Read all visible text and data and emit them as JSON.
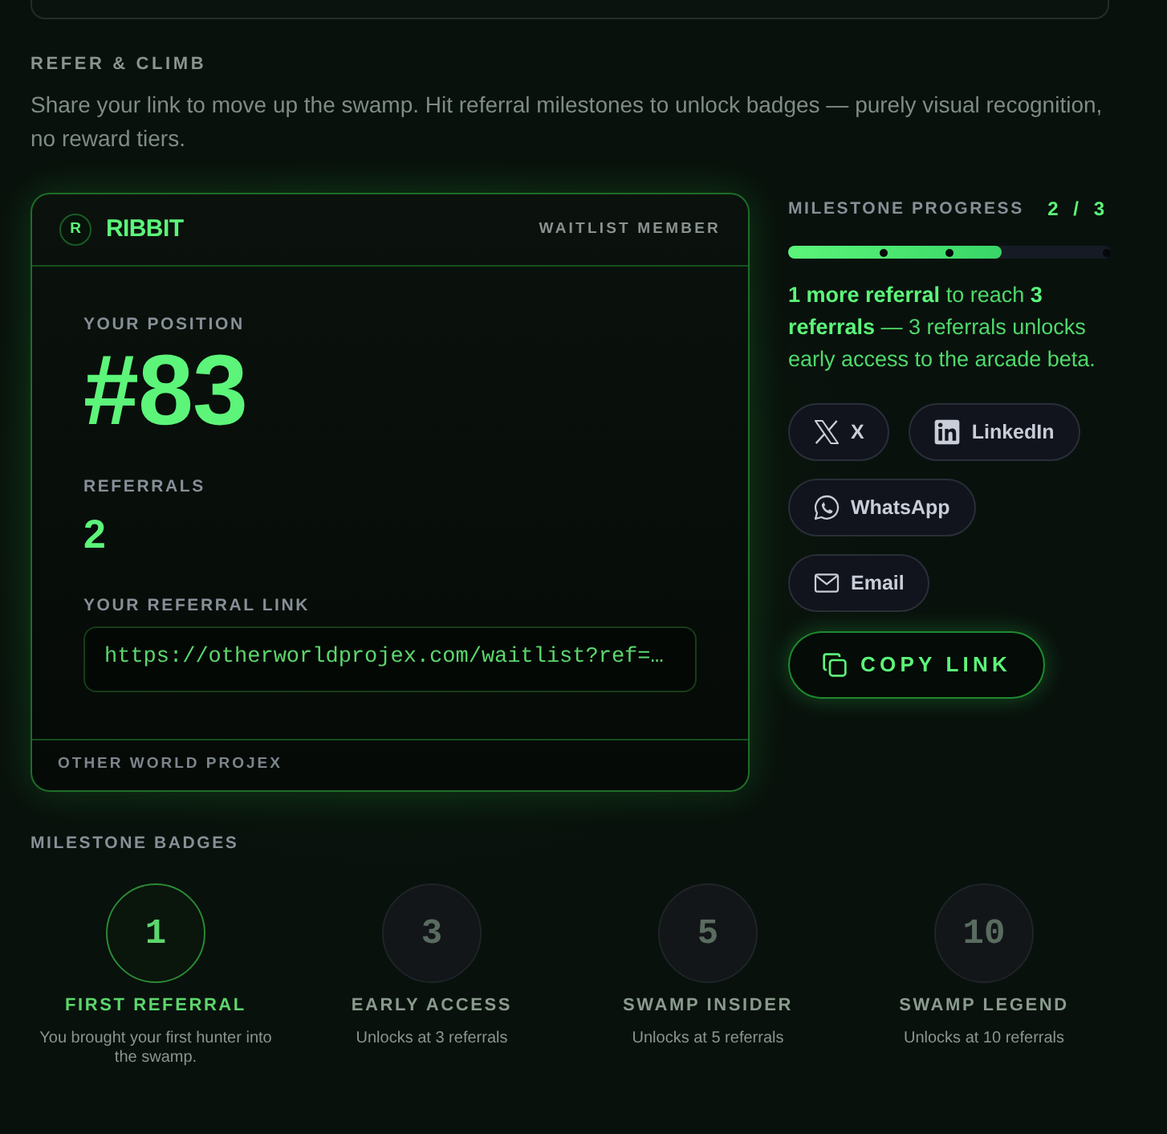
{
  "section": {
    "heading": "REFER & CLIMB",
    "description": "Share your link to move up the swamp. Hit referral milestones to unlock badges — purely visual recognition, no reward tiers."
  },
  "card": {
    "avatar": "R",
    "brand": "RIBBIT",
    "tag": "WAITLIST MEMBER",
    "position_label": "YOUR POSITION",
    "position": "#83",
    "referrals_label": "REFERRALS",
    "referrals": "2",
    "link_label": "YOUR REFERRAL LINK",
    "link": "https://otherworldprojex.com/waitlist?ref=…",
    "footer": "OTHER WORLD PROJEX"
  },
  "progress": {
    "label": "MILESTONE PROGRESS",
    "count": "2 / 3",
    "level": 0.66,
    "message": "**1 more referral** to reach **3 referrals** — 3 referrals unlocks early access to the arcade beta."
  },
  "share_buttons": [
    {
      "kind": "x",
      "label": "X"
    },
    {
      "kind": "linkedin",
      "label": "LinkedIn"
    },
    {
      "kind": "whatsapp",
      "label": "WhatsApp"
    },
    {
      "kind": "email",
      "label": "Email"
    }
  ],
  "copy_button": {
    "label": "COPY LINK"
  },
  "badges": {
    "heading": "MILESTONE BADGES",
    "items": [
      {
        "number": "1",
        "title": "FIRST REFERRAL",
        "description": "You brought your first hunter into the swamp.",
        "unlocked": true
      },
      {
        "number": "3",
        "title": "EARLY ACCESS",
        "description": "Unlocks at 3 referrals",
        "unlocked": false
      },
      {
        "number": "5",
        "title": "SWAMP INSIDER",
        "description": "Unlocks at 5 referrals",
        "unlocked": false
      },
      {
        "number": "10",
        "title": "SWAMP LEGEND",
        "description": "Unlocks at 10 referrals",
        "unlocked": false
      }
    ]
  }
}
